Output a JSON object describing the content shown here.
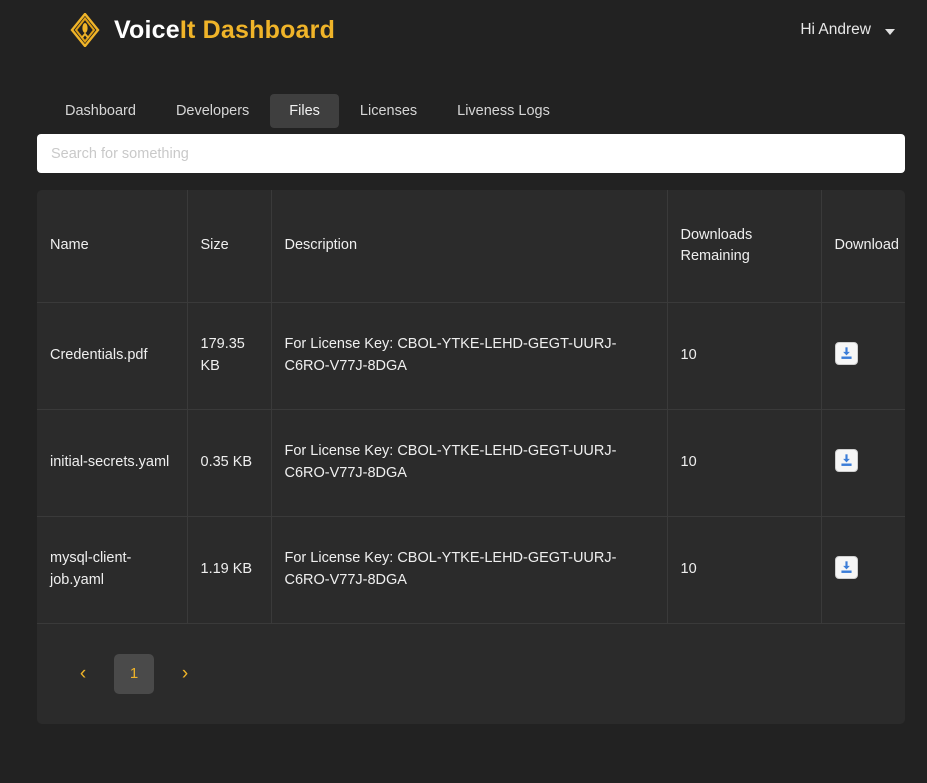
{
  "theme": {
    "page_bg": "#222222",
    "panel_bg": "#2b2b2b",
    "accent": "#f0b429",
    "active_tab_bg": "#3f3f3f",
    "border": "#3a3a3a",
    "download_icon_color": "#3b7dd8"
  },
  "header": {
    "brand_first": "Voice",
    "brand_second": "It Dashboard",
    "logo_icon": "voiceit-diamond-logo-icon",
    "user_greeting": "Hi Andrew",
    "caret_icon": "chevron-down-icon"
  },
  "nav": {
    "tabs": [
      {
        "label": "Dashboard",
        "active": false
      },
      {
        "label": "Developers",
        "active": false
      },
      {
        "label": "Files",
        "active": true
      },
      {
        "label": "Licenses",
        "active": false
      },
      {
        "label": "Liveness Logs",
        "active": false
      }
    ]
  },
  "search": {
    "value": "",
    "placeholder": "Search for something"
  },
  "table": {
    "columns": [
      "Name",
      "Size",
      "Description",
      "Downloads Remaining",
      "Download"
    ],
    "rows": [
      {
        "name": "Credentials.pdf",
        "size": "179.35 KB",
        "description": "For License Key: CBOL-YTKE-LEHD-GEGT-UURJ-C6RO-V77J-8DGA",
        "downloads_remaining": "10",
        "download_icon": "download-icon"
      },
      {
        "name": "initial-secrets.yaml",
        "size": "0.35 KB",
        "description": "For License Key: CBOL-YTKE-LEHD-GEGT-UURJ-C6RO-V77J-8DGA",
        "downloads_remaining": "10",
        "download_icon": "download-icon"
      },
      {
        "name": "mysql-client-job.yaml",
        "size": "1.19 KB",
        "description": "For License Key: CBOL-YTKE-LEHD-GEGT-UURJ-C6RO-V77J-8DGA",
        "downloads_remaining": "10",
        "download_icon": "download-icon"
      }
    ]
  },
  "pagination": {
    "prev_label": "‹",
    "next_label": "›",
    "current_page": "1"
  }
}
